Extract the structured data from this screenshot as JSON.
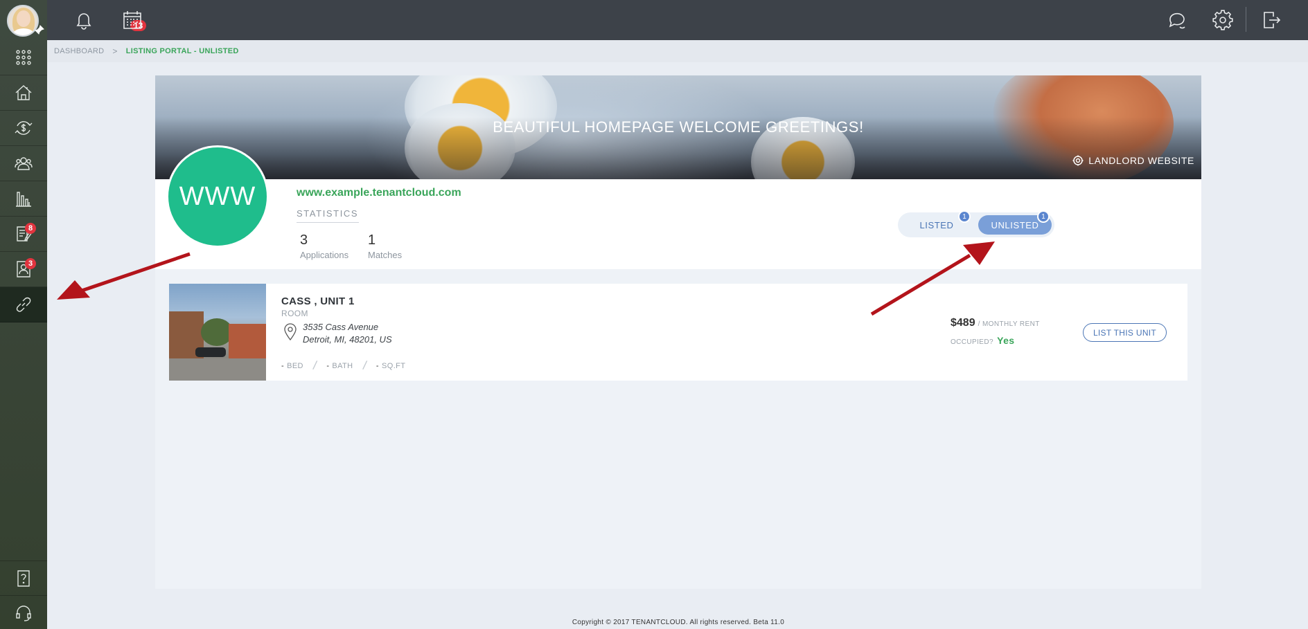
{
  "sidebar": {
    "items": [
      {
        "name": "apps-grid-icon"
      },
      {
        "name": "properties-icon"
      },
      {
        "name": "accounting-icon"
      },
      {
        "name": "tenants-icon"
      },
      {
        "name": "reports-icon"
      },
      {
        "name": "tasks-icon",
        "badge": "8"
      },
      {
        "name": "applications-icon",
        "badge": "3"
      },
      {
        "name": "listing-link-icon",
        "active": true
      }
    ],
    "bottom": [
      {
        "name": "help-icon"
      },
      {
        "name": "support-icon"
      }
    ]
  },
  "topbar": {
    "notifications_badge": "13",
    "icons": [
      "bell-icon",
      "calendar-icon",
      "chat-icon",
      "gear-icon",
      "logout-icon"
    ]
  },
  "breadcrumb": {
    "root": "DASHBOARD",
    "separator": ">",
    "current": "LISTING PORTAL - UNLISTED"
  },
  "banner": {
    "title": "BEAUTIFUL HOMEPAGE WELCOME GREETINGS!",
    "landlord_link": "LANDLORD WEBSITE"
  },
  "profile": {
    "logo_text": "WWW",
    "url": "www.example.tenantcloud.com",
    "stats_label": "STATISTICS",
    "stats": [
      {
        "value": "3",
        "label": "Applications"
      },
      {
        "value": "1",
        "label": "Matches"
      }
    ]
  },
  "toggle": {
    "listed_label": "LISTED",
    "listed_count": "1",
    "unlisted_label": "UNLISTED",
    "unlisted_count": "1",
    "selected": "unlisted"
  },
  "listing": {
    "title": "CASS , UNIT 1",
    "type": "ROOM",
    "address_line1": "3535 Cass Avenue",
    "address_line2": "Detroit, MI, 48201, US",
    "bed_value": "-",
    "bed_label": "BED",
    "bath_value": "-",
    "bath_label": "BATH",
    "sqft_value": "-",
    "sqft_label": "SQ.FT",
    "rent": "$489",
    "rent_label": "/ MONTHLY RENT",
    "occupied_label": "OCCUPIED?",
    "occupied_value": "Yes",
    "action_label": "LIST THIS UNIT"
  },
  "footer": {
    "text": "Copyright © 2017 TENANTCLOUD. All rights reserved. Beta 11.0"
  },
  "colors": {
    "accent_green": "#3aa55a",
    "logo_circle": "#1fbd8c",
    "toggle_active": "#7a9fd8",
    "badge_red": "#e2343f",
    "arrow_red": "#b3141b"
  }
}
